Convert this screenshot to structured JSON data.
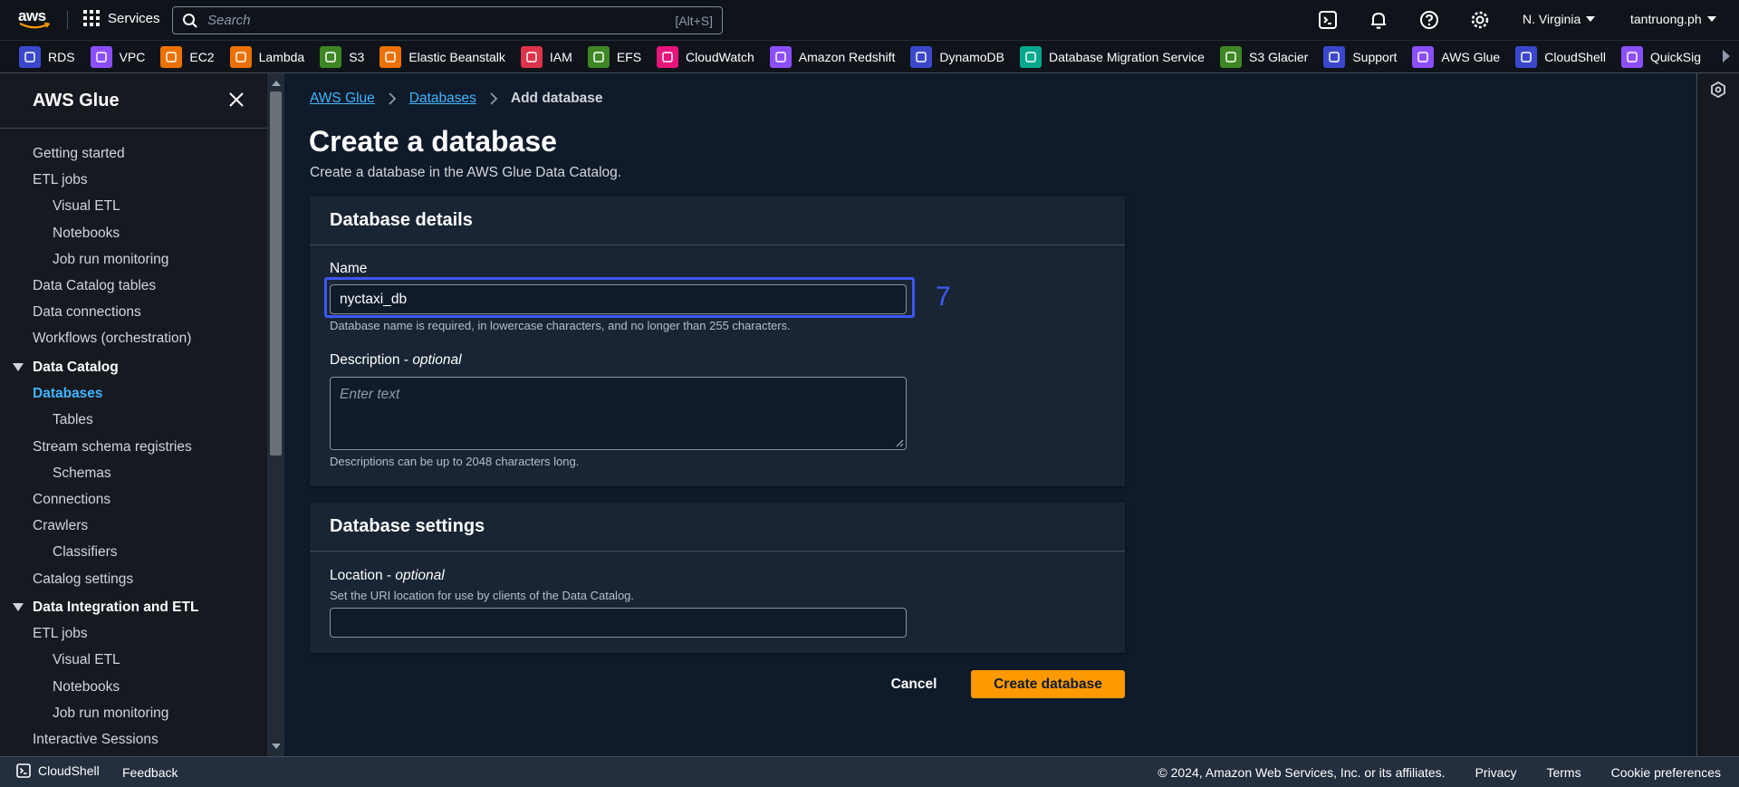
{
  "topnav": {
    "logo_text": "aws",
    "services_label": "Services",
    "search_placeholder": "Search",
    "search_shortcut": "[Alt+S]",
    "region": "N. Virginia",
    "user": "tantruong.ph"
  },
  "favorites": [
    {
      "label": "RDS",
      "icon": "rds-icon",
      "color": "#3b48cc"
    },
    {
      "label": "VPC",
      "icon": "vpc-icon",
      "color": "#8c4fff"
    },
    {
      "label": "EC2",
      "icon": "ec2-icon",
      "color": "#ed7100"
    },
    {
      "label": "Lambda",
      "icon": "lambda-icon",
      "color": "#ed7100"
    },
    {
      "label": "S3",
      "icon": "s3-icon",
      "color": "#3f8624"
    },
    {
      "label": "Elastic Beanstalk",
      "icon": "beanstalk-icon",
      "color": "#ed7100"
    },
    {
      "label": "IAM",
      "icon": "iam-icon",
      "color": "#dd344c"
    },
    {
      "label": "EFS",
      "icon": "efs-icon",
      "color": "#3f8624"
    },
    {
      "label": "CloudWatch",
      "icon": "cloudwatch-icon",
      "color": "#e7157b"
    },
    {
      "label": "Amazon Redshift",
      "icon": "redshift-icon",
      "color": "#8c4fff"
    },
    {
      "label": "DynamoDB",
      "icon": "dynamodb-icon",
      "color": "#3b48cc"
    },
    {
      "label": "Database Migration Service",
      "icon": "dms-icon",
      "color": "#01a88d"
    },
    {
      "label": "S3 Glacier",
      "icon": "glacier-icon",
      "color": "#3f8624"
    },
    {
      "label": "Support",
      "icon": "support-icon",
      "color": "#3b48cc"
    },
    {
      "label": "AWS Glue",
      "icon": "glue-icon",
      "color": "#8c4fff"
    },
    {
      "label": "CloudShell",
      "icon": "cloudshell-icon",
      "color": "#3b48cc"
    },
    {
      "label": "QuickSig",
      "icon": "quicksight-icon",
      "color": "#8c4fff"
    }
  ],
  "sidebar": {
    "title": "AWS Glue",
    "items": [
      {
        "label": "Getting started",
        "indent": 0,
        "type": "item"
      },
      {
        "label": "ETL jobs",
        "indent": 0,
        "type": "item"
      },
      {
        "label": "Visual ETL",
        "indent": 1,
        "type": "item"
      },
      {
        "label": "Notebooks",
        "indent": 1,
        "type": "item"
      },
      {
        "label": "Job run monitoring",
        "indent": 1,
        "type": "item"
      },
      {
        "label": "Data Catalog tables",
        "indent": 0,
        "type": "item"
      },
      {
        "label": "Data connections",
        "indent": 0,
        "type": "item"
      },
      {
        "label": "Workflows (orchestration)",
        "indent": 0,
        "type": "item"
      },
      {
        "label": "Data Catalog",
        "indent": 0,
        "type": "section"
      },
      {
        "label": "Databases",
        "indent": 0,
        "type": "active"
      },
      {
        "label": "Tables",
        "indent": 1,
        "type": "item"
      },
      {
        "label": "Stream schema registries",
        "indent": 0,
        "type": "item"
      },
      {
        "label": "Schemas",
        "indent": 1,
        "type": "item"
      },
      {
        "label": "Connections",
        "indent": 0,
        "type": "item"
      },
      {
        "label": "Crawlers",
        "indent": 0,
        "type": "item"
      },
      {
        "label": "Classifiers",
        "indent": 1,
        "type": "item"
      },
      {
        "label": "Catalog settings",
        "indent": 0,
        "type": "item"
      },
      {
        "label": "Data Integration and ETL",
        "indent": 0,
        "type": "section"
      },
      {
        "label": "ETL jobs",
        "indent": 0,
        "type": "item"
      },
      {
        "label": "Visual ETL",
        "indent": 1,
        "type": "item"
      },
      {
        "label": "Notebooks",
        "indent": 1,
        "type": "item"
      },
      {
        "label": "Job run monitoring",
        "indent": 1,
        "type": "item"
      },
      {
        "label": "Interactive Sessions",
        "indent": 0,
        "type": "item"
      }
    ]
  },
  "breadcrumb": {
    "items": [
      "AWS Glue",
      "Databases"
    ],
    "current": "Add database"
  },
  "page": {
    "title": "Create a database",
    "description": "Create a database in the AWS Glue Data Catalog."
  },
  "details": {
    "header": "Database details",
    "name_label": "Name",
    "name_value": "nyctaxi_db",
    "name_hint": "Database name is required, in lowercase characters, and no longer than 255 characters.",
    "desc_label": "Description - ",
    "desc_optional": "optional",
    "desc_placeholder": "Enter text",
    "desc_hint": "Descriptions can be up to 2048 characters long."
  },
  "settings": {
    "header": "Database settings",
    "loc_label": "Location - ",
    "loc_optional": "optional",
    "loc_hint": "Set the URI location for use by clients of the Data Catalog.",
    "loc_value": ""
  },
  "actions": {
    "cancel": "Cancel",
    "create": "Create database"
  },
  "annotation": {
    "step": "7",
    "color": "#3b59f5"
  },
  "footer": {
    "cloudshell": "CloudShell",
    "feedback": "Feedback",
    "copyright": "© 2024, Amazon Web Services, Inc. or its affiliates.",
    "privacy": "Privacy",
    "terms": "Terms",
    "cookies": "Cookie preferences"
  }
}
